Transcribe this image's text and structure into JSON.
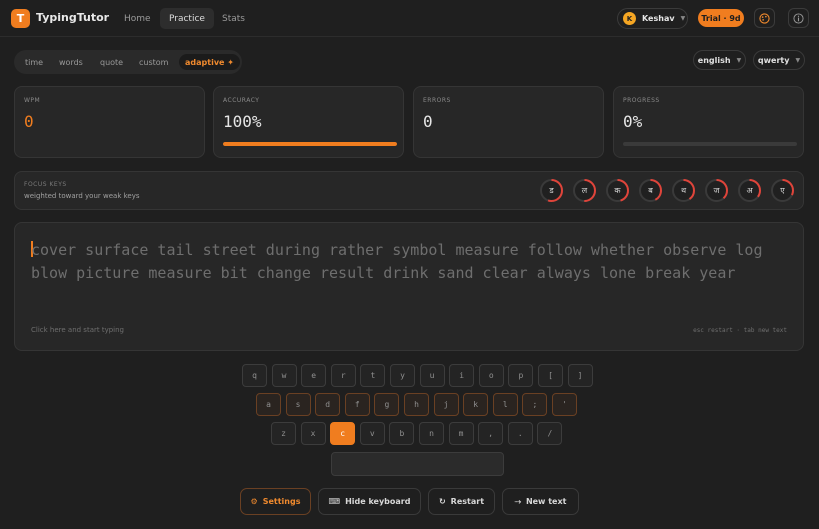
{
  "app": {
    "logo_letter": "T",
    "name": "TypingTutor"
  },
  "nav": [
    {
      "label": "Home"
    },
    {
      "label": "Practice"
    },
    {
      "label": "Stats"
    }
  ],
  "user": {
    "initial": "K",
    "name": "Keshav"
  },
  "trial_badge": "Trial · 9d",
  "icons": {
    "theme": "palette-icon",
    "info": "info-icon"
  },
  "modes": [
    {
      "label": "time"
    },
    {
      "label": "words"
    },
    {
      "label": "quote"
    },
    {
      "label": "custom"
    },
    {
      "label": "adaptive ✦"
    }
  ],
  "selects": {
    "language": "english",
    "layout": "qwerty"
  },
  "stats": {
    "wpm": {
      "label": "WPM",
      "value": "0"
    },
    "accuracy": {
      "label": "ACCURACY",
      "value": "100%",
      "level": 1.0
    },
    "errors": {
      "label": "ERRORS",
      "value": "0"
    },
    "progress": {
      "label": "PROGRESS",
      "value": "0%",
      "level": 0.0
    }
  },
  "focus": {
    "title": "FOCUS KEYS",
    "subtitle": "weighted toward your weak keys",
    "keys": [
      {
        "char": "ड",
        "level": 0.55
      },
      {
        "char": "ल",
        "level": 0.5
      },
      {
        "char": "क",
        "level": 0.45
      },
      {
        "char": "ब",
        "level": 0.42
      },
      {
        "char": "थ",
        "level": 0.4
      },
      {
        "char": "ज",
        "level": 0.38
      },
      {
        "char": "अ",
        "level": 0.35
      },
      {
        "char": "ए",
        "level": 0.32
      }
    ],
    "ring_color": "#e0443a"
  },
  "typing": {
    "line1": "cover surface tail street during rather symbol measure follow whether observe log",
    "line2": "blow picture measure bit change result drink sand clear always lone break year",
    "hint_left": "Click here and start typing",
    "hint_right": "esc restart · tab new text"
  },
  "keyboard": {
    "row1": [
      "q",
      "w",
      "e",
      "r",
      "t",
      "y",
      "u",
      "i",
      "o",
      "p",
      "[",
      "]"
    ],
    "row2": [
      "a",
      "s",
      "d",
      "f",
      "g",
      "h",
      "j",
      "k",
      "l",
      ";",
      "'"
    ],
    "row3": [
      "z",
      "x",
      "c",
      "v",
      "b",
      "n",
      "m",
      ",",
      ".",
      "/"
    ],
    "next_key": "c"
  },
  "actions": [
    {
      "icon": "⚙",
      "label": "Settings"
    },
    {
      "icon": "⌨",
      "label": "Hide keyboard"
    },
    {
      "icon": "↻",
      "label": "Restart"
    },
    {
      "icon": "⤑",
      "label": "New text"
    }
  ],
  "colors": {
    "accent": "#f07d1f",
    "background": "#1f1f1f"
  }
}
